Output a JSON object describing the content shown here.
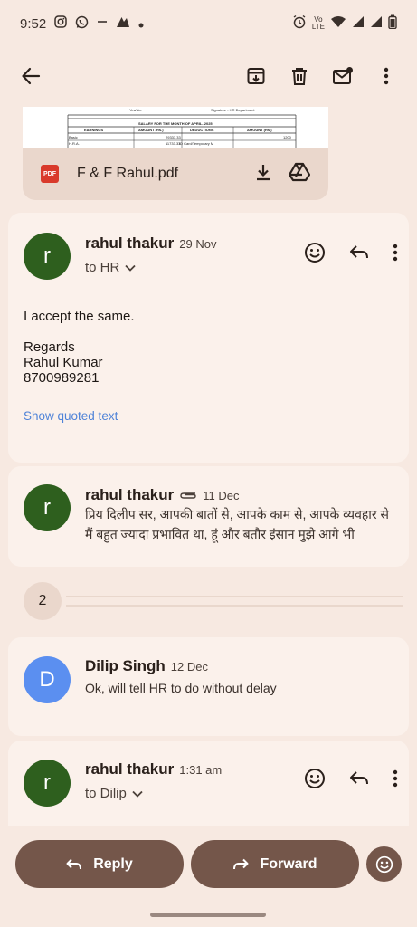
{
  "status_bar": {
    "time": "9:52",
    "network_label_top": "Vo",
    "network_label_bottom": "LTE"
  },
  "attachment": {
    "preview": {
      "header_text": "Yes/No.",
      "signature_text": "Signature - HR Department",
      "salary_title": "SALARY FOR THE MONTH OF APRIL- 2025",
      "col_earnings": "EARNINGS",
      "col_amount1": "AMOUNT (Rs.)",
      "col_deductions": "DEDUCTIONS",
      "col_amount2": "AMOUNT (Rs.)",
      "row1_label": "Basic",
      "row1_amount": "29333.33",
      "row1_ded_amt": "1200",
      "row2_label": "H.R.A.",
      "row2_amount": "11733.33",
      "row2_ded": "ID Card/Temporary M"
    },
    "badge": "PDF",
    "file_name": "F & F Rahul.pdf"
  },
  "messages": [
    {
      "avatar_letter": "r",
      "sender": "rahul thakur",
      "date": "29 Nov",
      "to": "to HR",
      "body": [
        "I accept the same.",
        "",
        "Regards",
        "Rahul Kumar",
        "8700989281"
      ],
      "quoted_link": "Show quoted text"
    },
    {
      "avatar_letter": "r",
      "sender": "rahul thakur",
      "date": "11 Dec",
      "snippet": "प्रिय दिलीप सर, आपकी बातों से, आपके काम से, आपके व्यवहार से मैं बहुत ज्यादा प्रभावित था, हूं और बतौर इंसान मुझे आगे भी"
    },
    {
      "avatar_letter": "D",
      "sender": "Dilip Singh",
      "date": "12 Dec",
      "snippet": "Ok, will tell HR to do without delay"
    },
    {
      "avatar_letter": "r",
      "sender": "rahul thakur",
      "date": "1:31 am",
      "to": "to Dilip"
    }
  ],
  "collapsed_count": "2",
  "bottom": {
    "reply_label": "Reply",
    "forward_label": "Forward"
  },
  "colors": {
    "background": "#f7e9e1",
    "card": "#fbf1eb",
    "pill": "#74564a",
    "avatar_green": "#2e5f1e",
    "avatar_blue": "#5b8ff0",
    "link": "#4f83d8"
  }
}
